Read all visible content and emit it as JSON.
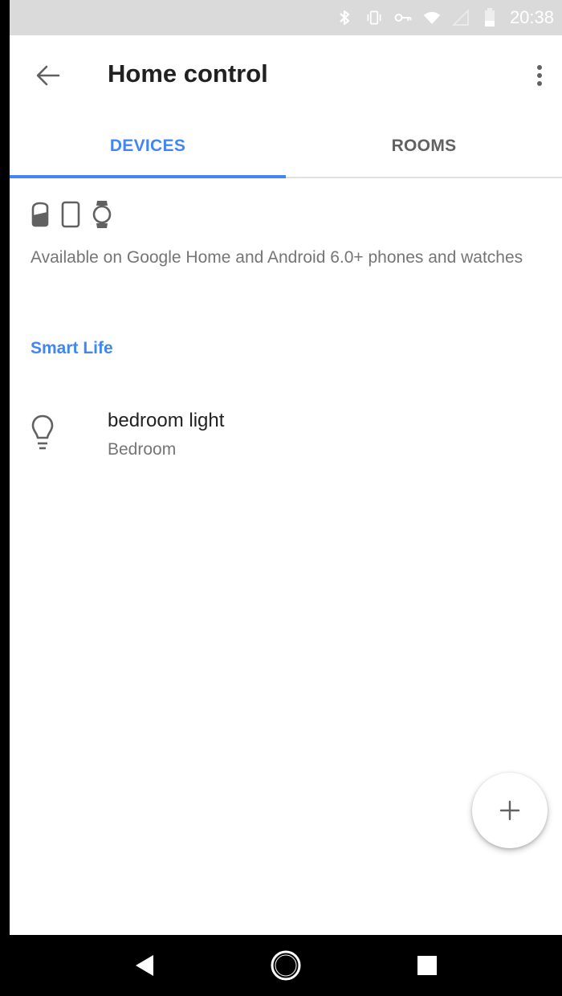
{
  "status_bar": {
    "time": "20:38",
    "icons": [
      "bluetooth-icon",
      "vibrate-icon",
      "vpn-key-icon",
      "wifi-icon",
      "no-signal-icon",
      "battery-icon"
    ]
  },
  "toolbar": {
    "title": "Home control",
    "back_icon": "arrow-back-icon",
    "more_icon": "more-vert-icon"
  },
  "tabs": [
    {
      "label": "DEVICES",
      "active": true
    },
    {
      "label": "ROOMS",
      "active": false
    }
  ],
  "availability": {
    "icons": [
      "google-home-icon",
      "phone-icon",
      "watch-icon"
    ],
    "text": "Available on Google Home and Android 6.0+ phones and watches"
  },
  "sections": [
    {
      "header": "Smart Life",
      "devices": [
        {
          "name": "bedroom light",
          "room": "Bedroom",
          "icon": "lightbulb-icon"
        }
      ]
    }
  ],
  "fab": {
    "icon": "add-icon"
  },
  "nav_bar": {
    "icons": [
      "back-triangle-icon",
      "home-circle-icon",
      "recents-square-icon"
    ]
  },
  "colors": {
    "accent": "#4285f4",
    "title": "#212121",
    "secondary_text": "#757575",
    "status_bar_bg": "#dadada",
    "nav_bar_bg": "#000000"
  }
}
